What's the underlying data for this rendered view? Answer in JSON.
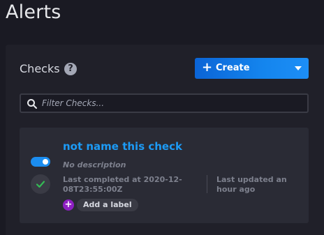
{
  "page": {
    "title": "Alerts"
  },
  "checks_panel": {
    "title": "Checks",
    "help_icon": "question-circle-icon",
    "create_button": {
      "label": "Create",
      "icon": "plus-icon",
      "dropdown_icon": "caret-down-icon"
    },
    "filter": {
      "placeholder": "Filter Checks...",
      "value": "",
      "icon": "search-icon"
    }
  },
  "checks": [
    {
      "name": "not name this check",
      "description": "No description",
      "enabled": true,
      "status": "success",
      "status_icon": "checkmark-icon",
      "last_completed": "Last completed at 2020-12-08T23:55:00Z",
      "last_updated": "Last updated an hour ago",
      "add_label": "Add a label"
    }
  ],
  "colors": {
    "background": "#1a1a23",
    "panel": "#202029",
    "card": "#2a2b35",
    "accent_blue": "#1485ee",
    "link_blue": "#1c9bf6",
    "success_green": "#34bb55",
    "label_purple": "#8e1fc3"
  }
}
